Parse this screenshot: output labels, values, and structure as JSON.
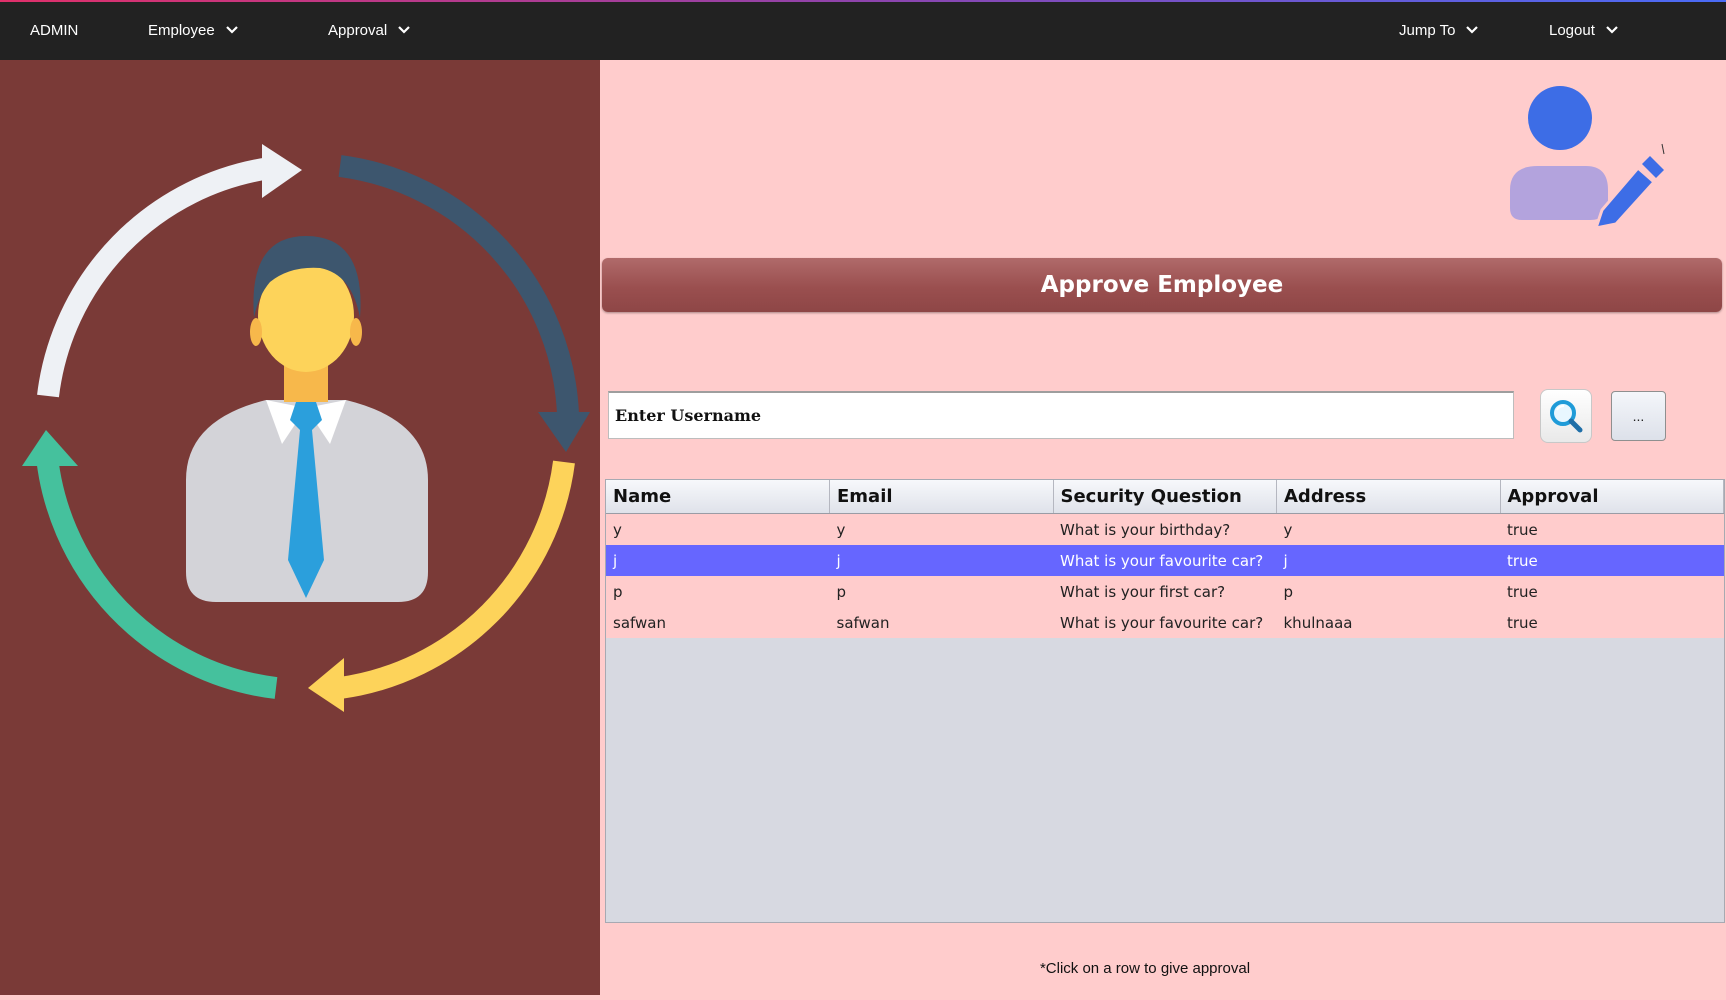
{
  "nav": {
    "brand": "ADMIN",
    "employee": "Employee",
    "approval": "Approval",
    "jump_to": "Jump To",
    "logout": "Logout"
  },
  "colors": {
    "nav_bg": "#222222",
    "left_panel": "#7a3a37",
    "right_panel": "#ffcccc",
    "title_bar": "#9a4f4f",
    "selected_row": "#6666ff"
  },
  "icons": {
    "illustration": "employee-cycle-illustration",
    "header": "user-edit-icon",
    "search": "magnifier-icon"
  },
  "page": {
    "title": "Approve Employee",
    "search_placeholder": "Enter Username",
    "more_button": "...",
    "hint": "*Click on a row to give approval"
  },
  "table": {
    "columns": [
      "Name",
      "Email",
      "Security Question",
      "Address",
      "Approval"
    ],
    "rows": [
      {
        "name": "y",
        "email": "y",
        "question": "What is your birthday?",
        "address": "y",
        "approval": "true",
        "selected": false
      },
      {
        "name": "j",
        "email": "j",
        "question": "What is your favourite car?",
        "address": "j",
        "approval": "true",
        "selected": true
      },
      {
        "name": "p",
        "email": "p",
        "question": "What is your first car?",
        "address": "p",
        "approval": "true",
        "selected": false
      },
      {
        "name": "safwan",
        "email": "safwan",
        "question": "What is your favourite car?",
        "address": "khulnaaa",
        "approval": "true",
        "selected": false
      }
    ]
  }
}
